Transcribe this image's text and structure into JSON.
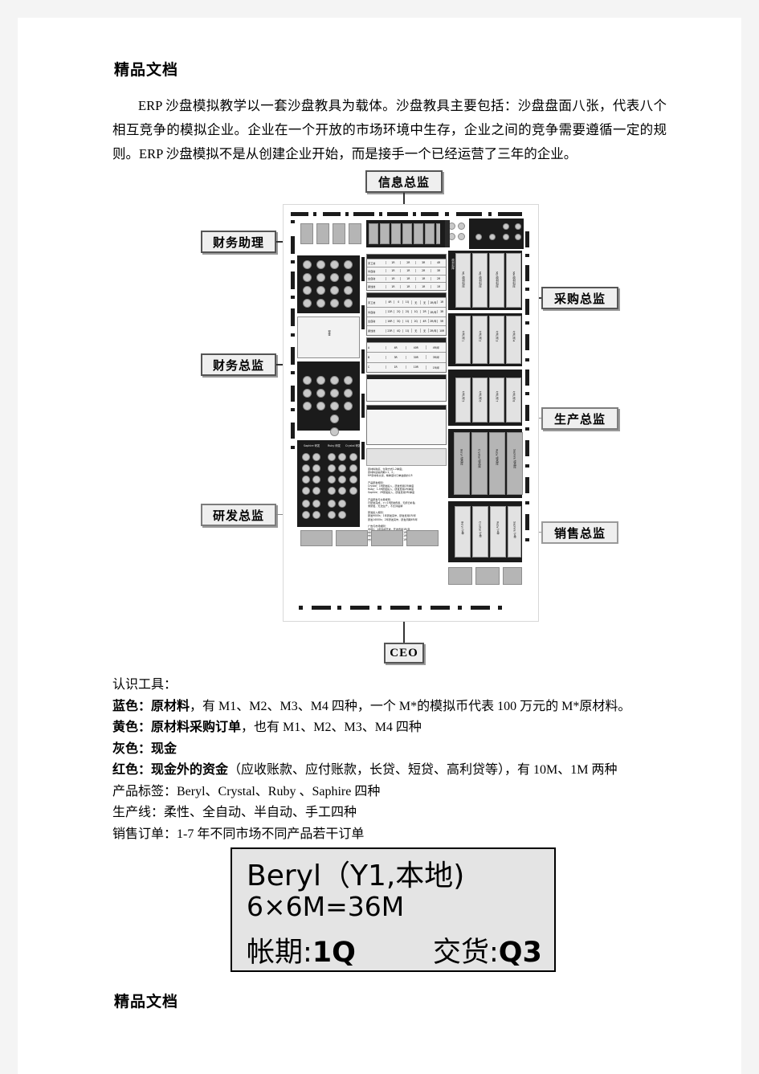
{
  "document": {
    "watermark_top": "精品文档",
    "watermark_bottom": "精品文档",
    "intro_paragraph": "ERP 沙盘模拟教学以一套沙盘教具为载体。沙盘教具主要包括：沙盘盘面八张，代表八个相互竞争的模拟企业。企业在一个开放的市场环境中生存，企业之间的竞争需要遵循一定的规则。ERP 沙盘模拟不是从创建企业开始，而是接手一个已经运营了三年的企业。"
  },
  "diagram": {
    "callouts": {
      "top": "信息总监",
      "left_1": "财务助理",
      "left_2": "财务总监",
      "left_3": "研发总监",
      "right_1": "采购总监",
      "right_2": "生产总监",
      "right_3": "销售总监",
      "bottom": "CEO"
    },
    "board": {
      "material_warehouses": [
        "M1 原材料库",
        "M2 原材料库",
        "M3 原材料库",
        "M4 原材料库"
      ],
      "material_warehouse_group_label": "原材料库",
      "production_lines_row1": [
        "生产线 1",
        "生产线 2",
        "生产线 3",
        "生产线 4"
      ],
      "production_lines_row2": [
        "生产线 5",
        "生产线 6",
        "生产线 7",
        "生产线 8"
      ],
      "product_warehouses": [
        "Beryl 成品库",
        "Crystal 成品库",
        "Ruby 成品库",
        "Saphire 成品库"
      ],
      "order_areas": [
        "Beryl 订单",
        "Crystal 订单",
        "Ruby 订单",
        "Saphire 订单"
      ],
      "rnd_columns": [
        "Saphire 研发",
        "Ruby 研发",
        "Crystal 研发"
      ],
      "cash_area_label": "现金",
      "table_products": [
        "Beryl",
        "Crystal",
        "Ruby",
        "Saphire"
      ],
      "table_title": "生产成本工单",
      "table_rows": [
        {
          "name": "手工线",
          "cells": [
            "1R",
            "2R",
            "3R",
            "4R"
          ]
        },
        {
          "name": "半自动",
          "cells": [
            "1R",
            "1R",
            "2R",
            "3R"
          ]
        },
        {
          "name": "全自动",
          "cells": [
            "1R",
            "1R",
            "1R",
            "2R"
          ]
        },
        {
          "name": "柔性线",
          "cells": [
            "1R",
            "1R",
            "1R",
            "1R"
          ]
        }
      ],
      "table2_title": "生产线调整周期与费用和损益",
      "table2_headers": [
        "购买价",
        "安装周期",
        "生产周期",
        "转产周期",
        "转产费用",
        "维护费用",
        "出售价格"
      ],
      "table2_rows": [
        {
          "name": "手工线",
          "cells": [
            "4R",
            "0",
            "1Q",
            "无",
            "无",
            "1R/年",
            "1R"
          ]
        },
        {
          "name": "半自动",
          "cells": [
            "12R",
            "2Q",
            "2Q",
            "1Q",
            "2R",
            "1R/年",
            "3R"
          ]
        },
        {
          "name": "全自动",
          "cells": [
            "16R",
            "3Q",
            "1Q",
            "2Q",
            "4R",
            "2R/年",
            "5R"
          ]
        },
        {
          "name": "柔性线",
          "cells": [
            "23R",
            "4Q",
            "1Q",
            "无",
            "无",
            "2R/年",
            "10R"
          ]
        }
      ],
      "table3_title": "厂房购买与租赁",
      "table3_headers": [
        "厂房",
        "容积",
        "售价",
        "租金"
      ],
      "table3_rows": [
        {
          "cells": [
            "A",
            "4R",
            "40R",
            "4R/年"
          ]
        },
        {
          "cells": [
            "B",
            "3R",
            "30R",
            "3R/年"
          ]
        },
        {
          "cells": [
            "C",
            "1R",
            "10R",
            "1R/年"
          ]
        }
      ],
      "sidebar_note": "设备价值（按年度1-2折旧）",
      "rules_text": "原材料购买、付款方式1-2季度；\n原材料运输周期=1、2；\nM*原材料交货，每季度付订单金额的1/5\n\n产品研发规则：\nCrystal：1R研发投入，研发费用1R/季度\nRuby：1.5R研发投入，研发费用2R/季度\nSaphire：2R研发投入，研发费用3R/季度\n\n产品研发与交易规则：\n已研发完成，>=1R研发费用，无折旧补贴\n未研发，无法生产，不允许贴牌\n\n研发投入规则：\n研发9000s：1年研发完毕，研发费用1R/年\n研发14000s：2年研发完毕，研发周期4R/年\n\n广告与市场规则：\n市场1，1年完成开发，开发费用1R/年\n市场2，2年完成开发，开发费用1R/年\n市场3，3年完成开发，开发费用1R/年\n市场4，4年完成开发，开发费用1R/年"
    }
  },
  "legend": {
    "heading": "认识工具：",
    "lines": [
      {
        "bold": "蓝色：原材料",
        "rest": "，有 M1、M2、M3、M4 四种，一个 M*的模拟币代表 100 万元的 M*原材料。"
      },
      {
        "bold": "黄色：原材料采购订单",
        "rest": "，也有 M1、M2、M3、M4 四种"
      },
      {
        "bold": "灰色：现金",
        "rest": ""
      },
      {
        "bold": "红色：现金外的资金",
        "rest": "（应收账款、应付账款，长贷、短贷、高利贷等），有 10M、1M 两种"
      },
      {
        "bold": "",
        "rest": "产品标签：Beryl、Crystal、Ruby 、Saphire 四种"
      },
      {
        "bold": "",
        "rest": "生产线：柔性、全自动、半自动、手工四种"
      },
      {
        "bold": "",
        "rest": "销售订单：1-7 年不同市场不同产品若干订单"
      }
    ]
  },
  "order_card": {
    "line1": "Beryl（Y1,本地)",
    "line2": "6×6M=36M",
    "line3_label": "帐期:",
    "line3_value": "1Q",
    "line4_label": "交货:",
    "line4_value": "Q3"
  }
}
